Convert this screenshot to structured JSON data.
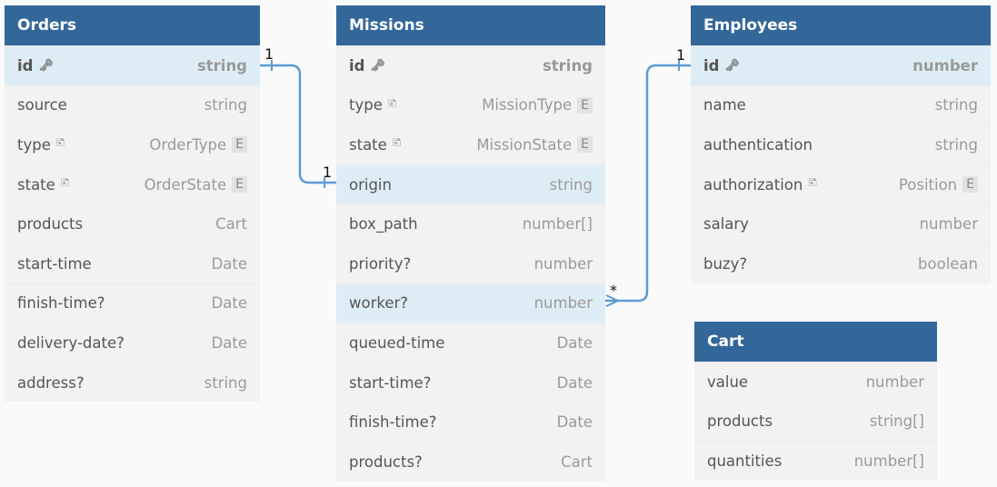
{
  "tables": [
    {
      "id": "orders",
      "title": "Orders",
      "rows": [
        {
          "name": "id",
          "type": "string",
          "key": true,
          "hl": true
        },
        {
          "name": "source",
          "type": "string"
        },
        {
          "name": "type",
          "type": "OrderType",
          "note": true,
          "enum": "E"
        },
        {
          "name": "state",
          "type": "OrderState",
          "note": true,
          "enum": "E"
        },
        {
          "name": "products",
          "type": "Cart"
        },
        {
          "name": "start-time",
          "type": "Date"
        },
        {
          "name": "finish-time?",
          "type": "Date"
        },
        {
          "name": "delivery-date?",
          "type": "Date"
        },
        {
          "name": "address?",
          "type": "string"
        }
      ]
    },
    {
      "id": "missions",
      "title": "Missions",
      "rows": [
        {
          "name": "id",
          "type": "string",
          "key": true
        },
        {
          "name": "type",
          "type": "MissionType",
          "note": true,
          "enum": "E"
        },
        {
          "name": "state",
          "type": "MissionState",
          "note": true,
          "enum": "E"
        },
        {
          "name": "origin",
          "type": "string",
          "hl": true
        },
        {
          "name": "box_path",
          "type": "number[]"
        },
        {
          "name": "priority?",
          "type": "number"
        },
        {
          "name": "worker?",
          "type": "number",
          "hl": true
        },
        {
          "name": "queued-time",
          "type": "Date"
        },
        {
          "name": "start-time?",
          "type": "Date"
        },
        {
          "name": "finish-time?",
          "type": "Date"
        },
        {
          "name": "products?",
          "type": "Cart"
        }
      ]
    },
    {
      "id": "employees",
      "title": "Employees",
      "rows": [
        {
          "name": "id",
          "type": "number",
          "key": true,
          "hl": true
        },
        {
          "name": "name",
          "type": "string"
        },
        {
          "name": "authentication",
          "type": "string"
        },
        {
          "name": "authorization",
          "type": "Position",
          "note": true,
          "enum": "E"
        },
        {
          "name": "salary",
          "type": "number"
        },
        {
          "name": "buzy?",
          "type": "boolean"
        }
      ]
    },
    {
      "id": "cart",
      "title": "Cart",
      "rows": [
        {
          "name": "value",
          "type": "number"
        },
        {
          "name": "products",
          "type": "string[]"
        },
        {
          "name": "quantities",
          "type": "number[]"
        }
      ]
    }
  ],
  "relations": [
    {
      "from": "Orders.id",
      "to": "Missions.origin",
      "from_card": "1",
      "to_card": "1"
    },
    {
      "from": "Missions.worker?",
      "to": "Employees.id",
      "from_card": "*",
      "to_card": "1"
    }
  ],
  "colors": {
    "header": "#33679a",
    "link": "#5b9bd5",
    "highlight": "#deedf5"
  }
}
